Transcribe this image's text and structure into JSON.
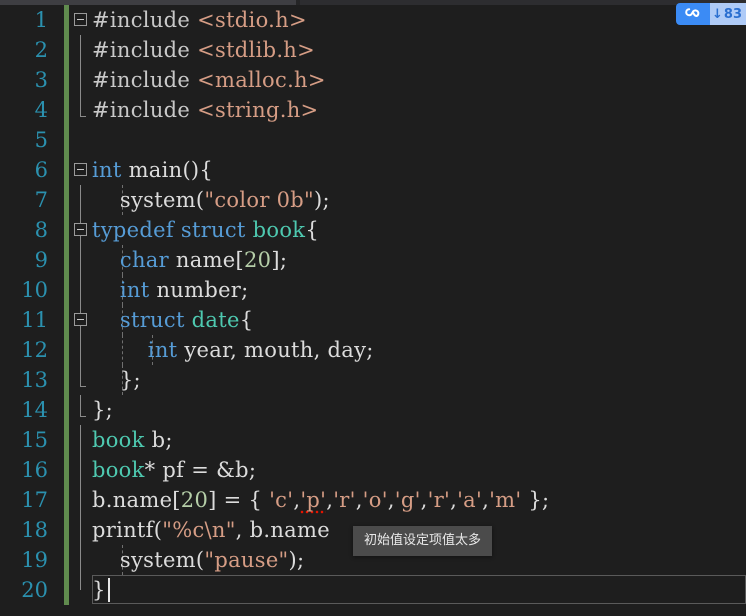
{
  "editor": {
    "theme_bg": "#1E1E1E",
    "line_number_color": "#2B91AF",
    "change_bar_color": "#608B4E",
    "lines": [
      {
        "n": "1",
        "text": "#include <stdio.h>"
      },
      {
        "n": "2",
        "text": "#include <stdlib.h>"
      },
      {
        "n": "3",
        "text": "#include <malloc.h>"
      },
      {
        "n": "4",
        "text": "#include <string.h>"
      },
      {
        "n": "5",
        "text": ""
      },
      {
        "n": "6",
        "text": "int main(){"
      },
      {
        "n": "7",
        "text": "    system(\"color 0b\");"
      },
      {
        "n": "8",
        "text": "typedef struct book{"
      },
      {
        "n": "9",
        "text": "    char name[20];"
      },
      {
        "n": "10",
        "text": "    int number;"
      },
      {
        "n": "11",
        "text": "    struct date{"
      },
      {
        "n": "12",
        "text": "        int year, mouth, day;"
      },
      {
        "n": "13",
        "text": "    };"
      },
      {
        "n": "14",
        "text": "};"
      },
      {
        "n": "15",
        "text": "book b;"
      },
      {
        "n": "16",
        "text": "book* pf = &b;"
      },
      {
        "n": "17",
        "text": "b.name[20] = { 'c','p','r','o','g','r','a','m' };"
      },
      {
        "n": "18",
        "text": "printf(\"%c\\n\", b.name"
      },
      {
        "n": "19",
        "text": "    system(\"pause\");"
      },
      {
        "n": "20",
        "text": "}"
      }
    ],
    "tokens": {
      "l1_hash": "#include",
      "l1_inc": " <stdio.h>",
      "l2_hash": "#include",
      "l2_inc": " <stdlib.h>",
      "l3_hash": "#include",
      "l3_inc": " <malloc.h>",
      "l4_hash": "#include",
      "l4_inc": " <string.h>",
      "l6_kw": "int",
      "l6_rest": " main(){",
      "l7_fn": "    system(",
      "l7_str": "\"color 0b\"",
      "l7_end": ");",
      "l8_kw": "typedef struct",
      "l8_typ": " book",
      "l8_brace": "{",
      "l9_kw": "    char",
      "l9_name": " name[",
      "l9_num": "20",
      "l9_end": "];",
      "l10_kw": "    int",
      "l10_rest": " number;",
      "l11_kw": "    struct",
      "l11_typ": " date",
      "l11_brace": "{",
      "l12_kw": "        int",
      "l12_rest": " year, mouth, day;",
      "l13": "    };",
      "l14": "};",
      "l15_typ": "book",
      "l15_rest": " b;",
      "l16_typ": "book",
      "l16_rest": "* pf = &b;",
      "l17_a": "b.name[",
      "l17_num": "20",
      "l17_b": "] = { ",
      "l17_c1": "'c'",
      "l17_c2": "'p'",
      "l17_c3": "'r'",
      "l17_c4": "'o'",
      "l17_c5": "'g'",
      "l17_c6": "'r'",
      "l17_c7": "'a'",
      "l17_c8": "'m'",
      "l17_comma": ",",
      "l17_end": " };",
      "l18_a": "printf(",
      "l18_str": "\"%c\\n\"",
      "l18_b": ", b.name",
      "l19_fn": "    system(",
      "l19_str": "\"pause\"",
      "l19_end": ");",
      "l20": "}"
    },
    "current_line": "20"
  },
  "tooltip": {
    "message": "初始值设定项值太多"
  },
  "badge": {
    "icon": "cloud-sync-icon",
    "arrow": "↓",
    "count": "83"
  }
}
